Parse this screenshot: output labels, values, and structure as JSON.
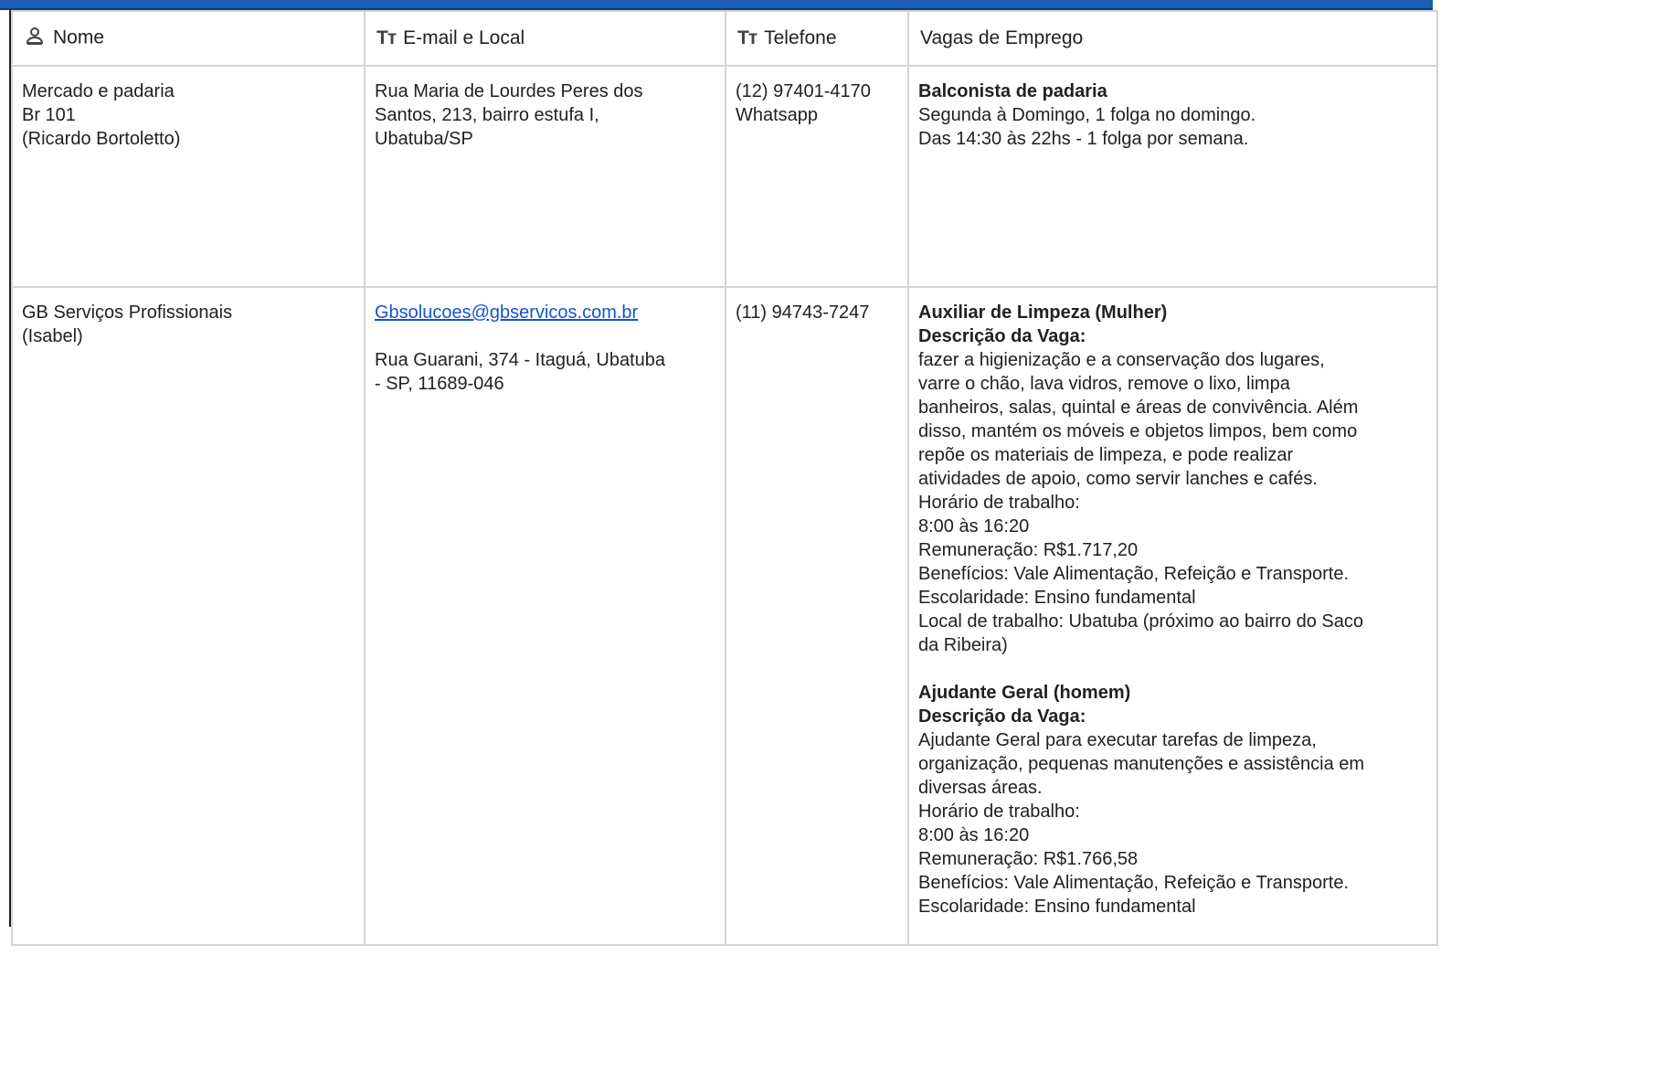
{
  "table": {
    "headers": {
      "name": "Nome",
      "email_location": "E-mail e Local",
      "phone": "Telefone",
      "jobs": "Vagas de Emprego"
    },
    "rows": [
      {
        "name_lines": [
          "Mercado e padaria",
          "Br 101",
          "(Ricardo Bortoletto)"
        ],
        "address_lines": [
          "Rua Maria de Lourdes Peres dos",
          "Santos, 213, bairro estufa I,",
          "Ubatuba/SP"
        ],
        "phone_lines": [
          "(12) 97401-4170",
          "Whatsapp"
        ],
        "job_title": "Balconista de padaria",
        "job_lines": [
          "Segunda à Domingo, 1 folga no domingo.",
          "Das 14:30 às 22hs - 1 folga por semana."
        ]
      },
      {
        "name_lines": [
          "GB Serviços Profissionais",
          "(Isabel)"
        ],
        "email": "Gbsolucoes@gbservicos.com.br",
        "address_lines": [
          "Rua Guarani, 374 - Itaguá, Ubatuba",
          "- SP, 11689-046"
        ],
        "phone_lines": [
          "(11) 94743-7247"
        ],
        "job1": {
          "title": "Auxiliar de Limpeza (Mulher)",
          "desc_label": "Descrição da Vaga:",
          "lines": [
            "fazer a higienização e a conservação dos lugares,",
            "varre o chão, lava vidros, remove o lixo, limpa",
            "banheiros, salas, quintal e áreas de convivência. Além",
            "disso, mantém os móveis e objetos limpos, bem como",
            "repõe os materiais de limpeza, e pode realizar",
            "atividades de apoio, como servir lanches e cafés.",
            "Horário de trabalho:",
            "8:00 às 16:20",
            "Remuneração: R$1.717,20",
            "Benefícios: Vale Alimentação, Refeição e Transporte.",
            "Escolaridade: Ensino fundamental",
            "Local de trabalho: Ubatuba (próximo ao bairro do Saco",
            "da Ribeira)"
          ]
        },
        "job2": {
          "title": "Ajudante Geral (homem)",
          "desc_label": "Descrição da Vaga:",
          "lines": [
            "Ajudante Geral para executar tarefas de limpeza,",
            "organização, pequenas manutenções e assistência em",
            "diversas áreas.",
            "Horário de trabalho:",
            "8:00 às 16:20",
            "Remuneração: R$1.766,58",
            "Benefícios: Vale Alimentação, Refeição e Transporte.",
            "Escolaridade: Ensino fundamental"
          ]
        }
      }
    ]
  },
  "colors": {
    "topbar": "#1a5fb4",
    "link": "#1155cc",
    "grid": "#d4d4d4"
  }
}
